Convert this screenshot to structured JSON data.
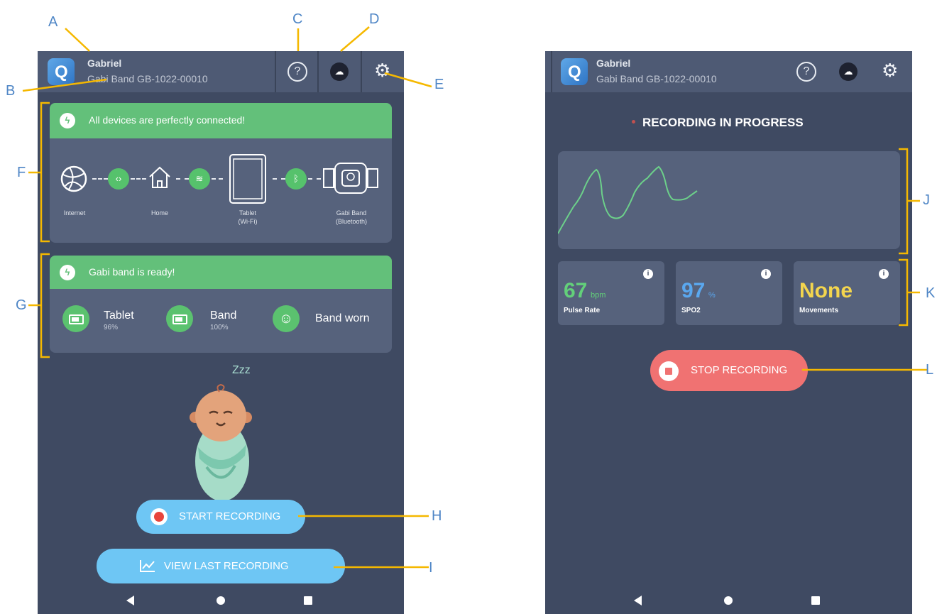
{
  "left_screen": {
    "header": {
      "user_name": "Gabriel",
      "band_id": "Gabi Band GB-1022-00010"
    },
    "connection_card": {
      "message": "All devices are perfectly connected!",
      "nodes": [
        {
          "label": "Internet"
        },
        {
          "label": "Home"
        },
        {
          "label": "Tablet\n(Wi-Fi)"
        },
        {
          "label": "Gabi Band\n(Bluetooth)"
        }
      ]
    },
    "status_card": {
      "message": "Gabi band is ready!",
      "tablet": {
        "label": "Tablet",
        "percent": "96%"
      },
      "band": {
        "label": "Band",
        "percent": "100%"
      },
      "worn": {
        "label": "Band worn"
      }
    },
    "sleep_text": "Zzz",
    "start_button": "START RECORDING",
    "view_button": "VIEW LAST RECORDING"
  },
  "right_screen": {
    "header": {
      "user_name": "Gabriel",
      "band_id": "Gabi Band GB-1022-00010"
    },
    "status": "RECORDING IN PROGRESS",
    "pulse": {
      "value": "67",
      "unit": "bpm",
      "label": "Pulse Rate"
    },
    "spo2": {
      "value": "97",
      "unit": "%",
      "label": "SPO2"
    },
    "movements": {
      "value": "None",
      "label": "Movements"
    },
    "stop_button": "STOP RECORDING"
  },
  "annotations": [
    "A",
    "B",
    "C",
    "D",
    "E",
    "F",
    "G",
    "H",
    "I",
    "J",
    "K",
    "L"
  ],
  "colors": {
    "accent": "#f5b800",
    "background": "#3f4a62",
    "card": "#56627c",
    "success": "#63c07a",
    "button_blue": "#6cc0f4",
    "stop_red": "#f07070"
  }
}
